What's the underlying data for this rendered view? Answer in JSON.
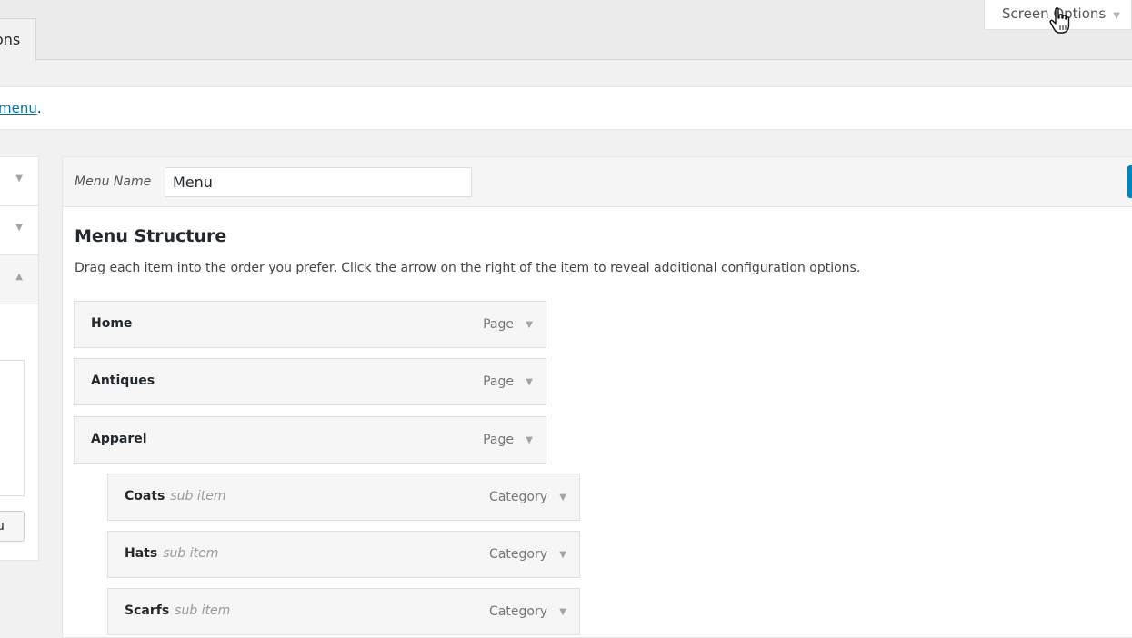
{
  "top_tab": {
    "label": "ons"
  },
  "screen_options": {
    "label": "Screen Options",
    "arrow": "▼"
  },
  "notice": {
    "link_text": "menu",
    "suffix": "."
  },
  "left_panel": {
    "accordions": [
      {
        "arrow": "▼"
      },
      {
        "arrow": "▼"
      },
      {
        "arrow": "▲"
      }
    ],
    "button_label": "u"
  },
  "menu_name": {
    "label": "Menu Name",
    "value": "Menu"
  },
  "structure": {
    "title": "Menu Structure",
    "description": "Drag each item into the order you prefer. Click the arrow on the right of the item to reveal additional configuration options."
  },
  "items": [
    {
      "title": "Home",
      "type": "Page",
      "sub": ""
    },
    {
      "title": "Antiques",
      "type": "Page",
      "sub": ""
    },
    {
      "title": "Apparel",
      "type": "Page",
      "sub": ""
    },
    {
      "title": "Coats",
      "type": "Category",
      "sub": "sub item"
    },
    {
      "title": "Hats",
      "type": "Category",
      "sub": "sub item"
    },
    {
      "title": "Scarfs",
      "type": "Category",
      "sub": "sub item"
    }
  ],
  "colors": {
    "link": "#0073aa",
    "primary_button": "#0085ba"
  }
}
